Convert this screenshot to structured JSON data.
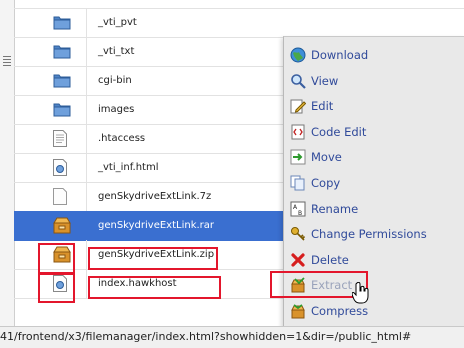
{
  "files": [
    {
      "name": "_vti_pvt",
      "type": "folder"
    },
    {
      "name": "_vti_txt",
      "type": "folder"
    },
    {
      "name": "cgi-bin",
      "type": "folder"
    },
    {
      "name": "images",
      "type": "folder"
    },
    {
      "name": ".htaccess",
      "type": "text-file"
    },
    {
      "name": "_vti_inf.html",
      "type": "html-file"
    },
    {
      "name": "genSkydriveExtLink.7z",
      "type": "blank-file"
    },
    {
      "name": "genSkydriveExtLink.rar",
      "type": "archive",
      "selected": true
    },
    {
      "name": "genSkydriveExtLink.zip",
      "type": "archive"
    },
    {
      "name": "index.hawkhost",
      "type": "html-file"
    }
  ],
  "context_menu": {
    "items": [
      {
        "label": "Download",
        "icon": "globe-download-icon"
      },
      {
        "label": "View",
        "icon": "magnifier-icon"
      },
      {
        "label": "Edit",
        "icon": "pencil-edit-icon"
      },
      {
        "label": "Code Edit",
        "icon": "code-edit-icon"
      },
      {
        "label": "Move",
        "icon": "move-arrow-icon"
      },
      {
        "label": "Copy",
        "icon": "copy-icon"
      },
      {
        "label": "Rename",
        "icon": "rename-icon"
      },
      {
        "label": "Change Permissions",
        "icon": "key-icon"
      },
      {
        "label": "Delete",
        "icon": "delete-x-icon"
      },
      {
        "label": "Extract",
        "icon": "extract-box-icon",
        "disabled": true
      },
      {
        "label": "Compress",
        "icon": "compress-box-icon"
      }
    ]
  },
  "status_bar": {
    "url": "41/frontend/x3/filemanager/index.html?showhidden=1&dir=/public_html#"
  },
  "colors": {
    "selection": "#3a6fd0",
    "highlight_box": "#e3162c",
    "menu_background": "#e9e9e9",
    "menu_text": "#304a9a"
  }
}
